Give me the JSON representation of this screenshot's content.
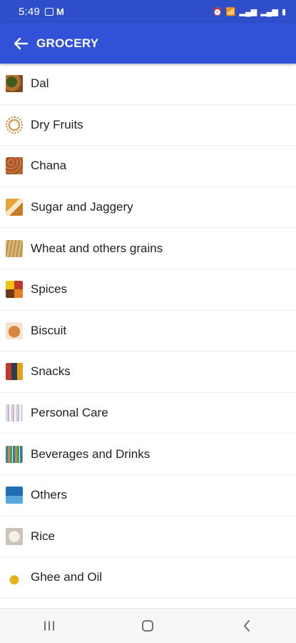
{
  "status_bar": {
    "time": "5:49",
    "left_icons": [
      "image-icon",
      "gmail-icon"
    ],
    "right_icons": [
      "alarm-icon",
      "wifi-icon",
      "signal-icon",
      "signal-icon",
      "battery-icon"
    ]
  },
  "app_bar": {
    "back_icon": "arrow-left-icon",
    "title": "GROCERY",
    "color": "#3152d6"
  },
  "categories": [
    {
      "label": "Dal",
      "icon": "dal-thumbnail"
    },
    {
      "label": "Dry Fruits",
      "icon": "dry-fruits-thumbnail"
    },
    {
      "label": "Chana",
      "icon": "chana-thumbnail"
    },
    {
      "label": "Sugar and Jaggery",
      "icon": "sugar-jaggery-thumbnail"
    },
    {
      "label": "Wheat and others grains",
      "icon": "wheat-grains-thumbnail"
    },
    {
      "label": "Spices",
      "icon": "spices-thumbnail"
    },
    {
      "label": "Biscuit",
      "icon": "biscuit-thumbnail"
    },
    {
      "label": "Snacks",
      "icon": "snacks-thumbnail"
    },
    {
      "label": "Personal Care",
      "icon": "personal-care-thumbnail"
    },
    {
      "label": "Beverages and Drinks",
      "icon": "beverages-thumbnail"
    },
    {
      "label": "Others",
      "icon": "others-thumbnail"
    },
    {
      "label": "Rice",
      "icon": "rice-thumbnail"
    },
    {
      "label": "Ghee and Oil",
      "icon": "ghee-oil-thumbnail"
    }
  ],
  "nav_bar": {
    "buttons": [
      "recent-apps-icon",
      "home-icon",
      "back-icon"
    ]
  }
}
